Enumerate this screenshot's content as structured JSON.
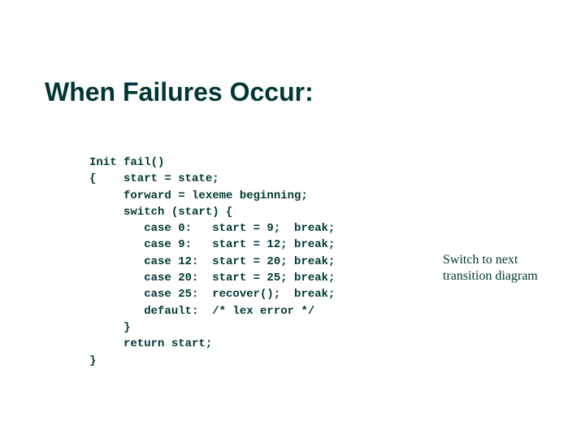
{
  "title": "When Failures Occur:",
  "code": "Init fail()\n{    start = state;\n     forward = lexeme beginning;\n     switch (start) {\n        case 0:   start = 9;  break;\n        case 9:   start = 12; break;\n        case 12:  start = 20; break;\n        case 20:  start = 25; break;\n        case 25:  recover();  break;\n        default:  /* lex error */\n     }\n     return start;\n}",
  "annotation": "Switch to next transition diagram"
}
